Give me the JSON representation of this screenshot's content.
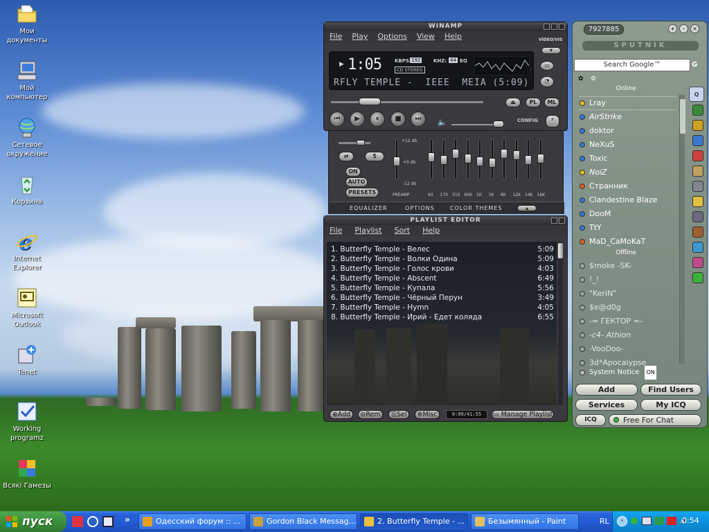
{
  "desktop_icons": [
    {
      "label": "Мои документы",
      "icon": "my-documents-folder-icon"
    },
    {
      "label": "Мой компьютер",
      "icon": "my-computer-icon"
    },
    {
      "label": "Сетевое окружение",
      "icon": "network-places-icon"
    },
    {
      "label": "Корзина",
      "icon": "recycle-bin-icon"
    },
    {
      "label": "Internet Explorer",
      "icon": "internet-explorer-icon"
    },
    {
      "label": "Microsoft Outlook",
      "icon": "outlook-icon"
    },
    {
      "label": "Tenet",
      "icon": "tenet-app-icon"
    },
    {
      "label": "Working programz",
      "icon": "working-programz-icon"
    },
    {
      "label": "Всякі Гамезы",
      "icon": "games-folder-icon"
    }
  ],
  "winamp": {
    "title": "WINAMP",
    "menu": [
      "File",
      "Play",
      "Options",
      "View",
      "Help"
    ],
    "time": "1:05",
    "kbps_label": "KBPS:",
    "kbps": "192",
    "khz_label": "KHZ:",
    "khz": "44",
    "eq_label": "EQ",
    "mode": "CD STEREO",
    "marquee": "RFLY TEMPLE -  IEEE  MEIA (5:09)",
    "video_vis": "VIDEO/VIS",
    "pl_label": "PL",
    "ml_label": "ML",
    "config": "CONFIG"
  },
  "equalizer": {
    "db_high": "+12 db",
    "db_mid": "+0 db",
    "db_low": "-12 db",
    "on": "ON",
    "auto": "AUTO",
    "presets": "PRESETS",
    "preamp": "PREAMP",
    "preset_value": "5",
    "bands": [
      "60",
      "170",
      "310",
      "600",
      "1K",
      "3K",
      "6K",
      "12K",
      "14K",
      "16K"
    ],
    "band_levels": [
      0.4,
      0.5,
      0.3,
      0.45,
      0.55,
      0.6,
      0.3,
      0.35,
      0.5,
      0.45
    ],
    "tabs": [
      "EQUALIZER",
      "OPTIONS",
      "COLOR THEMES"
    ]
  },
  "playlist": {
    "title": "PLAYLIST EDITOR",
    "menu": [
      "File",
      "Playlist",
      "Sort",
      "Help"
    ],
    "tracks": [
      {
        "title": "1. Butterfly Temple - Велес",
        "time": "5:09"
      },
      {
        "title": "2. Butterfly Temple - Волки Одина",
        "time": "5:09"
      },
      {
        "title": "3. Butterfly Temple - Голос крови",
        "time": "4:03"
      },
      {
        "title": "4. Butterfly Temple - Abscent",
        "time": "6:49"
      },
      {
        "title": "5. Butterfly Temple - Купала",
        "time": "5:56"
      },
      {
        "title": "6. Butterfly Temple - Чёрный Перун",
        "time": "3:49"
      },
      {
        "title": "7. Butterfly Temple - Hymn",
        "time": "4:05"
      },
      {
        "title": "8. Butterfly Temple - Ирий - Едет коляда",
        "time": "6:55"
      }
    ],
    "buttons": {
      "add": "Add",
      "rem": "Rem",
      "sel": "Sel",
      "misc": "Misc",
      "manage": "Manage Playlist"
    },
    "total_time": "0:00/41:55"
  },
  "icq": {
    "uin": "7927885",
    "brand": "SPUTNIK",
    "search_text": "Search Google™",
    "online_header": "Online",
    "offline_header": "Offline",
    "online": [
      {
        "name": "Lray",
        "color": "#e8c020"
      },
      {
        "name": "AirStrike",
        "color": "#2e7ae0"
      },
      {
        "name": "doktor",
        "color": "#2e7ae0"
      },
      {
        "name": "NeXuS",
        "color": "#2e7ae0"
      },
      {
        "name": "Toxic",
        "color": "#2e7ae0"
      },
      {
        "name": "NoiZ",
        "color": "#e8c020"
      },
      {
        "name": "Странник",
        "color": "#e06020"
      },
      {
        "name": "Clandestine Blaze",
        "color": "#2e7ae0"
      },
      {
        "name": "DooM",
        "color": "#2e7ae0"
      },
      {
        "name": "TtY",
        "color": "#2e7ae0"
      },
      {
        "name": "MaD_CaMoKaT",
        "color": "#e06020"
      }
    ],
    "offline": [
      "$moke -SK-",
      "!_!",
      "\"KeriN\"",
      "$e@d0g",
      "-= ГЕКТОР =-",
      "-c4- Athion",
      "-VooDoo-",
      "3d*Apocalypse"
    ],
    "system_notice": "System Notice",
    "buttons": {
      "add": "Add",
      "find": "Find Users",
      "services": "Services",
      "my_icq": "My ICQ"
    },
    "icq_label": "ICQ",
    "status": "Free For Chat"
  },
  "taskbar": {
    "start": "пуск",
    "items": [
      "Одесский форум :: ...",
      "Gordon Black Messag...",
      "2. Butterfly Temple - ...",
      "Безымянный - Paint"
    ],
    "lang": "RL",
    "clock": "0:54"
  }
}
